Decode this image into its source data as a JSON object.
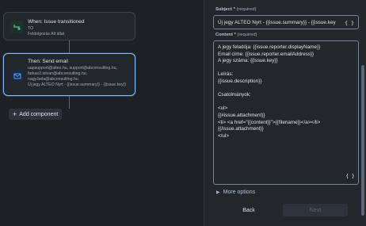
{
  "canvas": {
    "trigger": {
      "title": "When: Issue transitioned",
      "line1": "TO",
      "line2": "Feldolgozás Alt állat"
    },
    "action": {
      "title": "Then: Send email",
      "recipients": [
        "uapsupport@alteo.hu, support@abconsulting.hu,",
        "farkas2.istvan@abconsulting.hu,",
        "nagy.bela@abconsulting.hu"
      ],
      "subject_preview": "Új jegy ALTEO Nyrt - {{issue.summary}} - {{issue.key}}"
    },
    "add_component_label": "Add component"
  },
  "panel": {
    "subject": {
      "label": "Subject",
      "required_mark": "*",
      "required_note": "(required)",
      "value": "Új jegy ALTEO Nyrt - {{issue.summary}} - {{issue.key",
      "brace_label": "{ }"
    },
    "content": {
      "label": "Content",
      "required_mark": "*",
      "required_note": "(required)",
      "lines": [
        "A jegy feladója: {{issue.reporter.displayName}}",
        "Email címe: {{issue.reporter.emailAddress}}",
        "A jegy száma: {{issue.key}}",
        "",
        "Leírás:",
        "{{issue.description}}",
        "",
        "Csatolmányok:",
        "",
        "<ul>",
        "{{#issue.attachment}}",
        "<li> <a href=\"{{content}}\">{{filename}}</a></li>",
        "{{/issue.attachment}}",
        "</ul>"
      ],
      "brace_label": "{ }"
    },
    "more_options_label": "More options",
    "back_label": "Back",
    "next_label": "Next"
  },
  "colors": {
    "background": "#1d2125",
    "panel": "#22272b",
    "selected_border": "#85b8ff",
    "trigger_icon": "#4bce97",
    "mail_icon": "#579dff"
  }
}
